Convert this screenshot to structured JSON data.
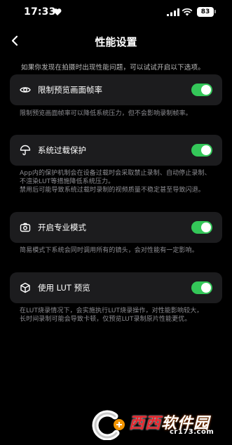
{
  "status": {
    "time": "17:33",
    "battery": "83"
  },
  "nav": {
    "title": "性能设置"
  },
  "intro": "如果你发现在拍摄时出现性能问题，可以试试开启以下选项。",
  "settings": [
    {
      "label": "限制预览画面帧率",
      "icon": "eye-icon",
      "enabled": true,
      "desc": [
        "限制预览画面帧率可以降低系统压力，但不会影响录制帧率。"
      ]
    },
    {
      "label": "系统过载保护",
      "icon": "umbrella-icon",
      "enabled": true,
      "desc": [
        "App内的保护机制会在设备过载时会采取禁止录制、自动停止录制、",
        "不渲染LUT等措施降低系统压力。",
        "禁用后可能导致系统过载时录制的视频质量不稳定甚至导致闪退。"
      ]
    },
    {
      "label": "开启专业模式",
      "icon": "camera-icon",
      "enabled": true,
      "desc": [
        "简易模式下系统会同时调用所有的镜头，会对性能有一定影响。"
      ]
    },
    {
      "label": "使用 LUT 预览",
      "icon": "cube-icon",
      "enabled": true,
      "desc": [
        "在LUT烧录情况下，会实施执行LUT烧录操作，对性能影响较大，",
        "长时间录制可能会导致卡顿，仅预览LUT录制原片性能更优。"
      ]
    }
  ],
  "watermark": {
    "brand_a": "西西",
    "brand_b": "软件园",
    "sub": "cr173.com"
  },
  "colors": {
    "background": "#000000",
    "card": "#1c1c1e",
    "toggle_on": "#34c759"
  }
}
